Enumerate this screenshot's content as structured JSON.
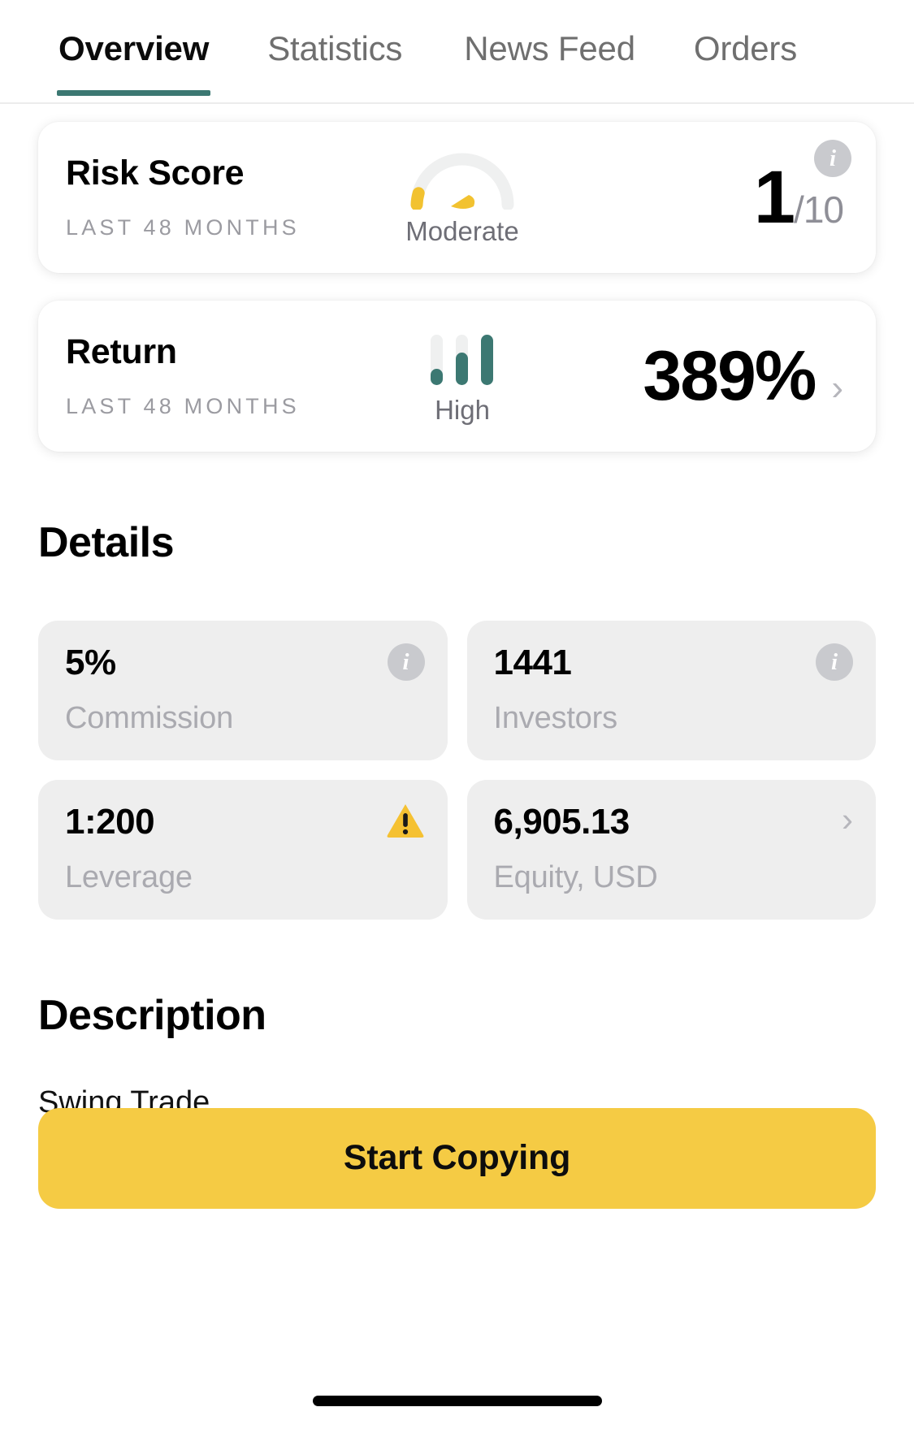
{
  "tabs": [
    {
      "label": "Overview",
      "active": true
    },
    {
      "label": "Statistics",
      "active": false
    },
    {
      "label": "News Feed",
      "active": false
    },
    {
      "label": "Orders",
      "active": false
    }
  ],
  "summary": {
    "risk": {
      "title": "Risk Score",
      "period": "LAST 48 MONTHS",
      "gauge_label": "Moderate",
      "value": "1",
      "denominator": "/10",
      "gauge_level": 1,
      "gauge_max": 10,
      "info_icon": "info-icon"
    },
    "return": {
      "title": "Return",
      "period": "LAST 48 MONTHS",
      "bars_label": "High",
      "value": "389%",
      "bars_level": 3,
      "bars_max": 3,
      "chevron_icon": "chevron-right-icon"
    }
  },
  "details": {
    "heading": "Details",
    "cards": [
      {
        "value": "5%",
        "label": "Commission",
        "corner_icon": "info-icon"
      },
      {
        "value": "1441",
        "label": "Investors",
        "corner_icon": "info-icon"
      },
      {
        "value": "1:200",
        "label": "Leverage",
        "corner_icon": "warning-triangle-icon"
      },
      {
        "value": "6,905.13",
        "label": "Equity, USD",
        "corner_icon": "chevron-right-icon"
      }
    ]
  },
  "description": {
    "heading": "Description",
    "body": "Swing Trade"
  },
  "cta": {
    "label": "Start Copying"
  },
  "colors": {
    "accent_teal": "#3c7872",
    "accent_yellow": "#f5cb44",
    "gauge_yellow": "#f2c230",
    "card_gray": "#eeeeee",
    "muted_text": "#aaaab0",
    "track_gray": "#eff0f0"
  }
}
